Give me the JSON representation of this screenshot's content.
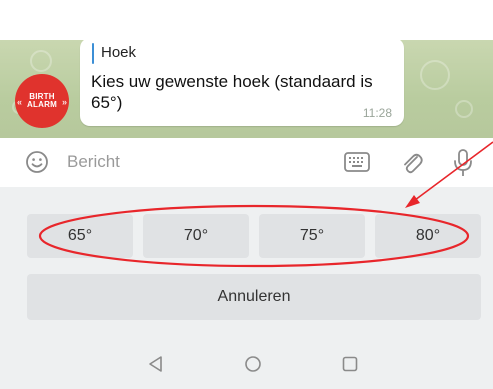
{
  "chat": {
    "avatar_logo_line1": "BIRTH",
    "avatar_logo_line2": "ALARM",
    "reply_title": "Hoek",
    "message_text": "Kies uw gewenste hoek (standaard is 65°)",
    "message_time": "11:28"
  },
  "input": {
    "placeholder": "Bericht",
    "icons": [
      "smile-icon",
      "keyboard-icon",
      "paperclip-icon",
      "microphone-icon"
    ]
  },
  "keyboard": {
    "buttons": [
      "65°",
      "70°",
      "75°",
      "80°"
    ],
    "cancel_label": "Annuleren"
  },
  "nav": {
    "icons": [
      "back-triangle-icon",
      "home-circle-icon",
      "recents-square-icon"
    ]
  },
  "colors": {
    "annotation": "#e8262b",
    "brand_red": "#e0332d",
    "reply_accent": "#3c8fd6",
    "chat_bg": "#c2d3a8",
    "keyboard_bg": "#eef0f1"
  }
}
